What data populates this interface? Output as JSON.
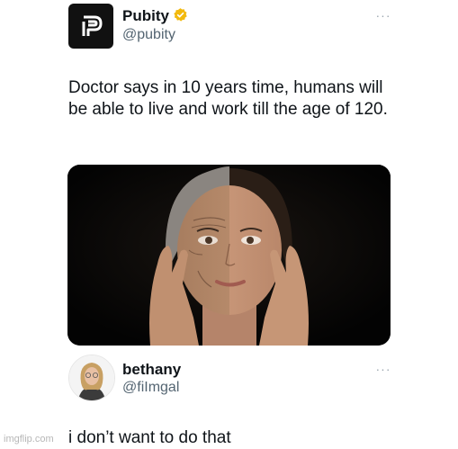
{
  "tweet": {
    "display_name": "Pubity",
    "handle": "@pubity",
    "text": "Doctor says in 10 years time, humans will be able to live and work till the age of 120.",
    "more": "···",
    "verified_color": "#f2b90d",
    "avatar_icon": "pubity-logo-icon",
    "media_description_icon": "face-aging-photo"
  },
  "reply": {
    "display_name": "bethany",
    "handle": "@fiImgal",
    "text": "i don’t want to do that",
    "more": "···",
    "avatar_icon": "user-avatar"
  },
  "watermark": "imgflip.com",
  "colors": {
    "text": "#0f1419",
    "secondary": "#536471",
    "background": "#ffffff"
  }
}
